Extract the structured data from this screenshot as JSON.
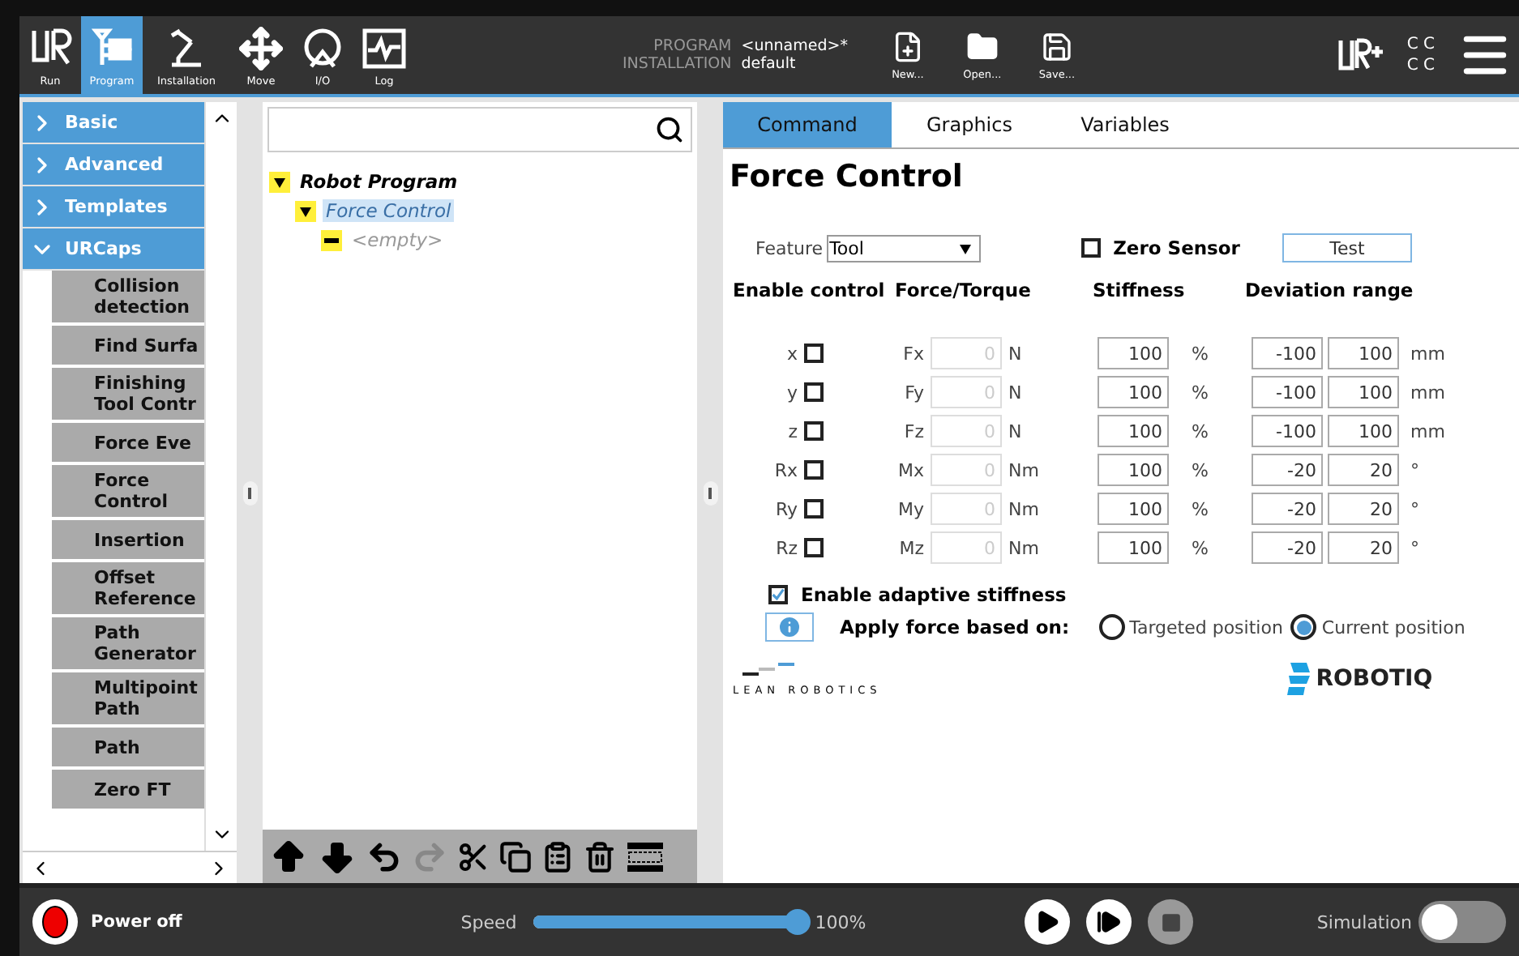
{
  "header": {
    "nav": [
      {
        "label": "Run",
        "selected": false
      },
      {
        "label": "Program",
        "selected": true
      },
      {
        "label": "Installation",
        "selected": false
      },
      {
        "label": "Move",
        "selected": false
      },
      {
        "label": "I/O",
        "selected": false
      },
      {
        "label": "Log",
        "selected": false
      }
    ],
    "program_label": "PROGRAM",
    "program_value": "<unnamed>*",
    "installation_label": "INSTALLATION",
    "installation_value": "default",
    "file_buttons": [
      "New...",
      "Open...",
      "Save..."
    ],
    "status_lines": [
      "C C",
      "C C"
    ]
  },
  "categories": [
    {
      "label": "Basic",
      "expanded": false
    },
    {
      "label": "Advanced",
      "expanded": false
    },
    {
      "label": "Templates",
      "expanded": false
    },
    {
      "label": "URCaps",
      "expanded": true
    }
  ],
  "urcaps": [
    "Collision detection",
    "Find Surfa",
    "Finishing Tool Contr",
    "Force Eve",
    "Force Control",
    "Insertion",
    "Offset Reference",
    "Path Generator",
    "Multipoint Path",
    "Path",
    "Zero FT"
  ],
  "tree": {
    "label": "Robot Program",
    "expanded": true,
    "children": [
      {
        "label": "Force Control",
        "selected": true,
        "expanded": true,
        "children": [
          {
            "label": "<empty>",
            "kind": "placeholder"
          }
        ]
      }
    ]
  },
  "tabs": [
    {
      "label": "Command",
      "selected": true
    },
    {
      "label": "Graphics",
      "selected": false
    },
    {
      "label": "Variables",
      "selected": false
    }
  ],
  "title": "Force Control",
  "feature": {
    "label": "Feature",
    "value": "Tool"
  },
  "zero_sensor": {
    "label": "Zero Sensor",
    "checked": false
  },
  "test_button": "Test",
  "column_headers": [
    "Enable control",
    "Force/Torque",
    "Stiffness",
    "Deviation range"
  ],
  "axes": [
    {
      "axis": "x",
      "enabled": false,
      "force_label": "Fx",
      "force": "0",
      "force_unit": "N",
      "stiffness": "100",
      "stiffness_unit": "%",
      "dev_min": "-100",
      "dev_max": "100",
      "dev_unit": "mm"
    },
    {
      "axis": "y",
      "enabled": false,
      "force_label": "Fy",
      "force": "0",
      "force_unit": "N",
      "stiffness": "100",
      "stiffness_unit": "%",
      "dev_min": "-100",
      "dev_max": "100",
      "dev_unit": "mm"
    },
    {
      "axis": "z",
      "enabled": false,
      "force_label": "Fz",
      "force": "0",
      "force_unit": "N",
      "stiffness": "100",
      "stiffness_unit": "%",
      "dev_min": "-100",
      "dev_max": "100",
      "dev_unit": "mm"
    },
    {
      "axis": "Rx",
      "enabled": false,
      "force_label": "Mx",
      "force": "0",
      "force_unit": "Nm",
      "stiffness": "100",
      "stiffness_unit": "%",
      "dev_min": "-20",
      "dev_max": "20",
      "dev_unit": "°"
    },
    {
      "axis": "Ry",
      "enabled": false,
      "force_label": "My",
      "force": "0",
      "force_unit": "Nm",
      "stiffness": "100",
      "stiffness_unit": "%",
      "dev_min": "-20",
      "dev_max": "20",
      "dev_unit": "°"
    },
    {
      "axis": "Rz",
      "enabled": false,
      "force_label": "Mz",
      "force": "0",
      "force_unit": "Nm",
      "stiffness": "100",
      "stiffness_unit": "%",
      "dev_min": "-20",
      "dev_max": "20",
      "dev_unit": "°"
    }
  ],
  "adaptive_stiffness": {
    "label": "Enable adaptive stiffness",
    "checked": true
  },
  "apply_force": {
    "label": "Apply force based on:",
    "options": [
      {
        "label": "Targeted position",
        "selected": false
      },
      {
        "label": "Current position",
        "selected": true
      }
    ]
  },
  "logos": {
    "lean": "LEAN ROBOTICS",
    "robotiq": "ROBOTIQ"
  },
  "footer": {
    "power": "Power off",
    "speed_label": "Speed",
    "speed": {
      "level": 1.0
    },
    "speed_reading": "100%",
    "simulation_label": "Simulation",
    "simulation_on": false
  }
}
